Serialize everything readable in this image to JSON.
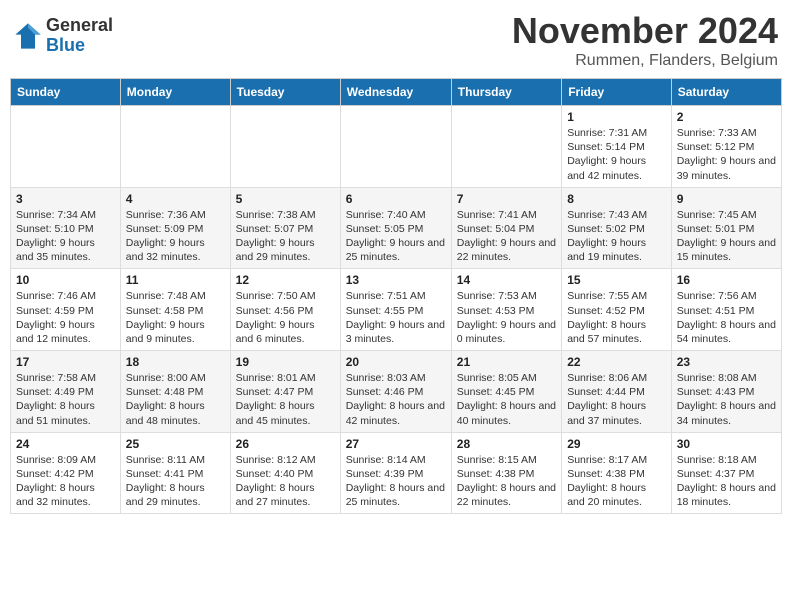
{
  "logo": {
    "general": "General",
    "blue": "Blue"
  },
  "title": "November 2024",
  "location": "Rummen, Flanders, Belgium",
  "days_of_week": [
    "Sunday",
    "Monday",
    "Tuesday",
    "Wednesday",
    "Thursday",
    "Friday",
    "Saturday"
  ],
  "weeks": [
    [
      {
        "day": "",
        "info": ""
      },
      {
        "day": "",
        "info": ""
      },
      {
        "day": "",
        "info": ""
      },
      {
        "day": "",
        "info": ""
      },
      {
        "day": "",
        "info": ""
      },
      {
        "day": "1",
        "info": "Sunrise: 7:31 AM\nSunset: 5:14 PM\nDaylight: 9 hours and 42 minutes."
      },
      {
        "day": "2",
        "info": "Sunrise: 7:33 AM\nSunset: 5:12 PM\nDaylight: 9 hours and 39 minutes."
      }
    ],
    [
      {
        "day": "3",
        "info": "Sunrise: 7:34 AM\nSunset: 5:10 PM\nDaylight: 9 hours and 35 minutes."
      },
      {
        "day": "4",
        "info": "Sunrise: 7:36 AM\nSunset: 5:09 PM\nDaylight: 9 hours and 32 minutes."
      },
      {
        "day": "5",
        "info": "Sunrise: 7:38 AM\nSunset: 5:07 PM\nDaylight: 9 hours and 29 minutes."
      },
      {
        "day": "6",
        "info": "Sunrise: 7:40 AM\nSunset: 5:05 PM\nDaylight: 9 hours and 25 minutes."
      },
      {
        "day": "7",
        "info": "Sunrise: 7:41 AM\nSunset: 5:04 PM\nDaylight: 9 hours and 22 minutes."
      },
      {
        "day": "8",
        "info": "Sunrise: 7:43 AM\nSunset: 5:02 PM\nDaylight: 9 hours and 19 minutes."
      },
      {
        "day": "9",
        "info": "Sunrise: 7:45 AM\nSunset: 5:01 PM\nDaylight: 9 hours and 15 minutes."
      }
    ],
    [
      {
        "day": "10",
        "info": "Sunrise: 7:46 AM\nSunset: 4:59 PM\nDaylight: 9 hours and 12 minutes."
      },
      {
        "day": "11",
        "info": "Sunrise: 7:48 AM\nSunset: 4:58 PM\nDaylight: 9 hours and 9 minutes."
      },
      {
        "day": "12",
        "info": "Sunrise: 7:50 AM\nSunset: 4:56 PM\nDaylight: 9 hours and 6 minutes."
      },
      {
        "day": "13",
        "info": "Sunrise: 7:51 AM\nSunset: 4:55 PM\nDaylight: 9 hours and 3 minutes."
      },
      {
        "day": "14",
        "info": "Sunrise: 7:53 AM\nSunset: 4:53 PM\nDaylight: 9 hours and 0 minutes."
      },
      {
        "day": "15",
        "info": "Sunrise: 7:55 AM\nSunset: 4:52 PM\nDaylight: 8 hours and 57 minutes."
      },
      {
        "day": "16",
        "info": "Sunrise: 7:56 AM\nSunset: 4:51 PM\nDaylight: 8 hours and 54 minutes."
      }
    ],
    [
      {
        "day": "17",
        "info": "Sunrise: 7:58 AM\nSunset: 4:49 PM\nDaylight: 8 hours and 51 minutes."
      },
      {
        "day": "18",
        "info": "Sunrise: 8:00 AM\nSunset: 4:48 PM\nDaylight: 8 hours and 48 minutes."
      },
      {
        "day": "19",
        "info": "Sunrise: 8:01 AM\nSunset: 4:47 PM\nDaylight: 8 hours and 45 minutes."
      },
      {
        "day": "20",
        "info": "Sunrise: 8:03 AM\nSunset: 4:46 PM\nDaylight: 8 hours and 42 minutes."
      },
      {
        "day": "21",
        "info": "Sunrise: 8:05 AM\nSunset: 4:45 PM\nDaylight: 8 hours and 40 minutes."
      },
      {
        "day": "22",
        "info": "Sunrise: 8:06 AM\nSunset: 4:44 PM\nDaylight: 8 hours and 37 minutes."
      },
      {
        "day": "23",
        "info": "Sunrise: 8:08 AM\nSunset: 4:43 PM\nDaylight: 8 hours and 34 minutes."
      }
    ],
    [
      {
        "day": "24",
        "info": "Sunrise: 8:09 AM\nSunset: 4:42 PM\nDaylight: 8 hours and 32 minutes."
      },
      {
        "day": "25",
        "info": "Sunrise: 8:11 AM\nSunset: 4:41 PM\nDaylight: 8 hours and 29 minutes."
      },
      {
        "day": "26",
        "info": "Sunrise: 8:12 AM\nSunset: 4:40 PM\nDaylight: 8 hours and 27 minutes."
      },
      {
        "day": "27",
        "info": "Sunrise: 8:14 AM\nSunset: 4:39 PM\nDaylight: 8 hours and 25 minutes."
      },
      {
        "day": "28",
        "info": "Sunrise: 8:15 AM\nSunset: 4:38 PM\nDaylight: 8 hours and 22 minutes."
      },
      {
        "day": "29",
        "info": "Sunrise: 8:17 AM\nSunset: 4:38 PM\nDaylight: 8 hours and 20 minutes."
      },
      {
        "day": "30",
        "info": "Sunrise: 8:18 AM\nSunset: 4:37 PM\nDaylight: 8 hours and 18 minutes."
      }
    ]
  ]
}
